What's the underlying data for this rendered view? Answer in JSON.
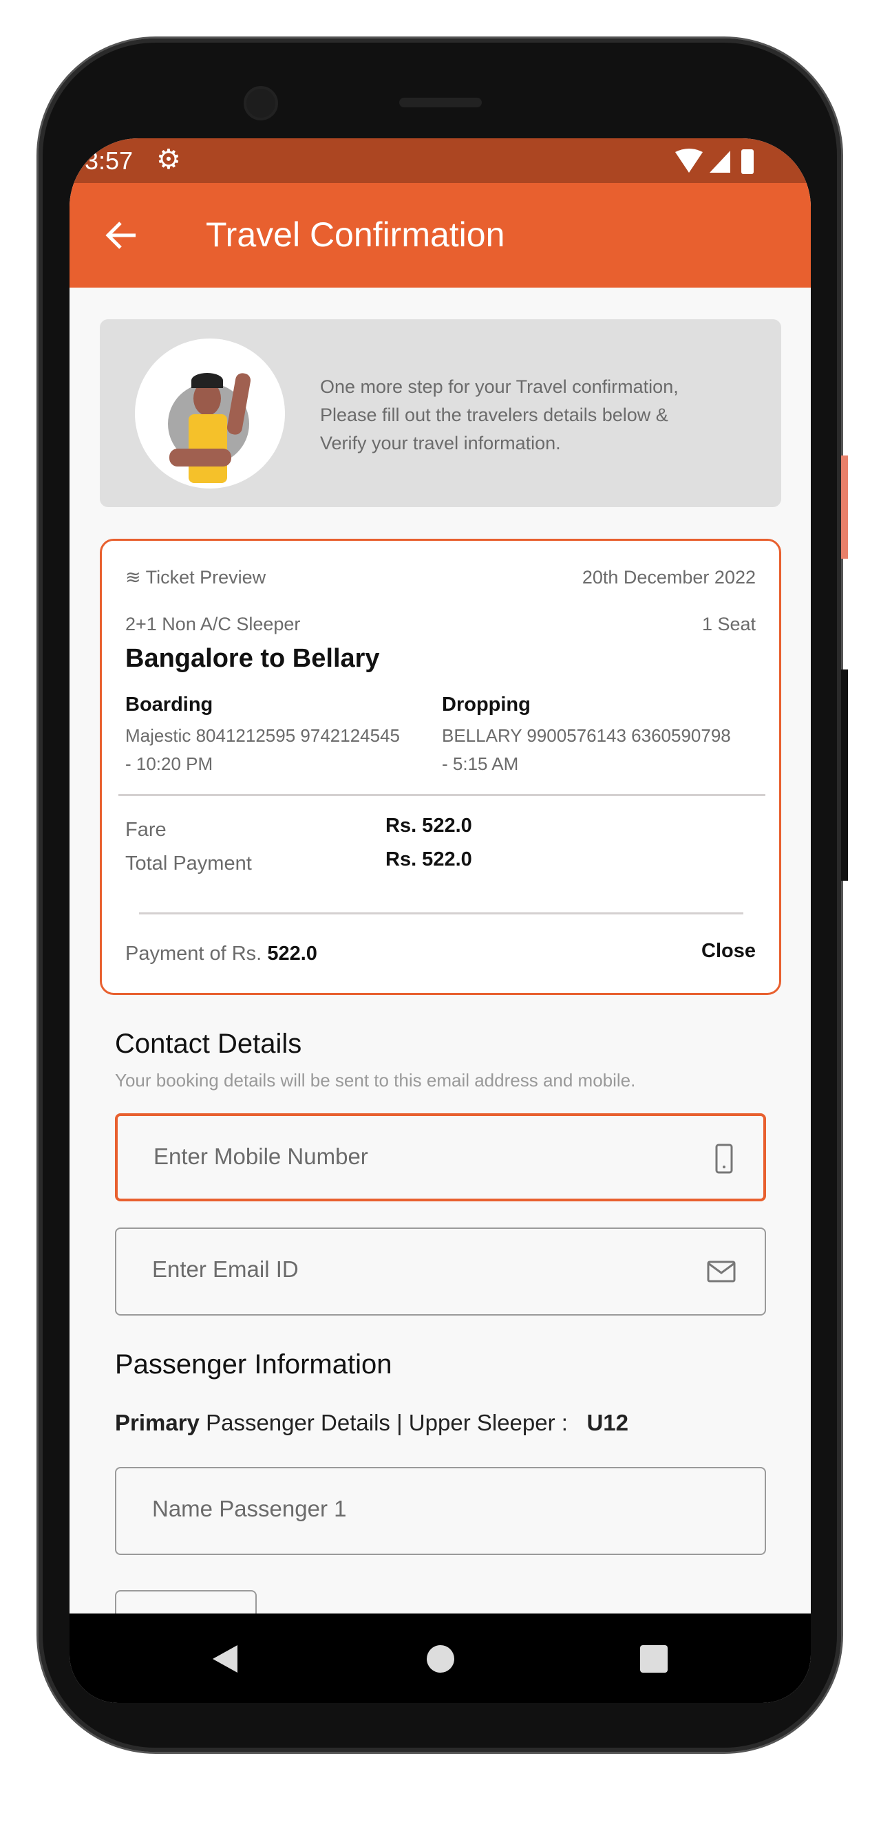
{
  "status_bar": {
    "time": "3:57",
    "icons": [
      "gear-icon",
      "wifi-icon",
      "signal-icon",
      "battery-icon"
    ]
  },
  "app_bar": {
    "title": "Travel Confirmation",
    "back_icon": "arrow-left-icon"
  },
  "info": {
    "line1": "One more step for your Travel confirmation,",
    "line2": "Please fill out the travelers details below &",
    "line3": "Verify your travel information."
  },
  "ticket": {
    "label": "Ticket Preview",
    "date": "20th December 2022",
    "bus_type": "2+1 Non A/C Sleeper",
    "seats": "1 Seat",
    "route": "Bangalore to Bellary",
    "boarding_label": "Boarding",
    "boarding_line1": "Majestic 8041212595 9742124545",
    "boarding_line2": "- 10:20 PM",
    "dropping_label": "Dropping",
    "dropping_line1": "BELLARY 9900576143 6360590798",
    "dropping_line2": "- 5:15 AM",
    "fare_label": "Fare",
    "fare_value": "Rs. 522.0",
    "total_label": "Total Payment",
    "total_value": "Rs. 522.0",
    "payment_prefix": "Payment of Rs.",
    "payment_amount": "522.0",
    "close_label": "Close"
  },
  "contact": {
    "title": "Contact Details",
    "subtitle": "Your booking details will be sent to this email address and mobile.",
    "mobile_placeholder": "Enter Mobile Number",
    "email_placeholder": "Enter Email ID"
  },
  "passenger": {
    "title": "Passenger Information",
    "primary_bold": "Primary",
    "primary_rest": "Passenger Details | Upper Sleeper :",
    "seat": "U12",
    "name_placeholder": "Name Passenger 1"
  },
  "colors": {
    "accent": "#E8602F",
    "status": "#AC4622"
  }
}
